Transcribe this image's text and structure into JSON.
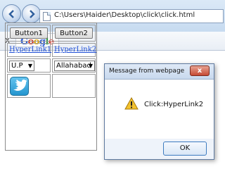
{
  "browser": {
    "address": "C:\\Users\\Haider\\Desktop\\click\\click.html",
    "toolbar_close": "x",
    "google_logo": "Google"
  },
  "page": {
    "button1": "Button1",
    "button2": "Button2",
    "hyperlink1": "HyperLink1",
    "hyperlink2": "HyperLink2",
    "select1": "U.P",
    "select2": "Allahabad"
  },
  "dialog": {
    "title": "Message from webpage",
    "message": "Click:HyperLink2",
    "ok_label": "OK",
    "close_glyph": "x"
  },
  "icons": [
    "back-icon",
    "forward-icon",
    "page-icon",
    "twitter-icon",
    "warning-icon",
    "close-icon"
  ],
  "colors": {
    "link": "#1f4fd6",
    "twitter": "#2496cf",
    "close_button": "#c64a33"
  }
}
